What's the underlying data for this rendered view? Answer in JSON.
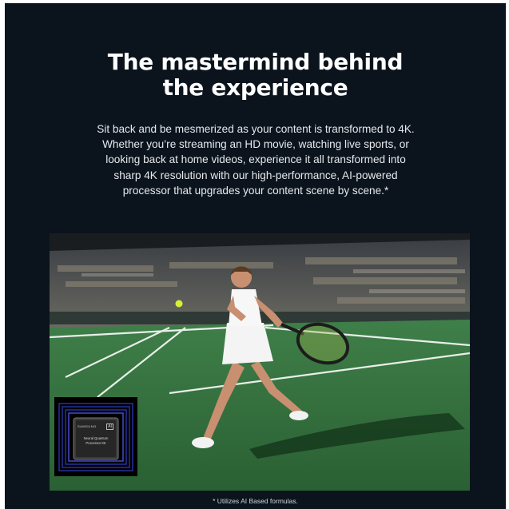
{
  "headline": {
    "line1": "The mastermind behind",
    "line2": "the experience"
  },
  "body_text": "Sit back and be mesmerized as your content is transformed to 4K. Whether you’re streaming an HD movie, watching live sports, or looking back at home videos, experience it all transformed into sharp 4K resolution with our high-performance, AI-powered processor that upgrades your content scene by scene.*",
  "chip": {
    "brand": "SAMSUNG",
    "badge": "AI",
    "name_line1": "Neural Quantum",
    "name_line2": "Processor 8K"
  },
  "footnote": "* Utilizes AI Based formulas.",
  "colors": {
    "background": "#0b141d",
    "court": "#2f6b3a",
    "headline": "#ffffff"
  }
}
